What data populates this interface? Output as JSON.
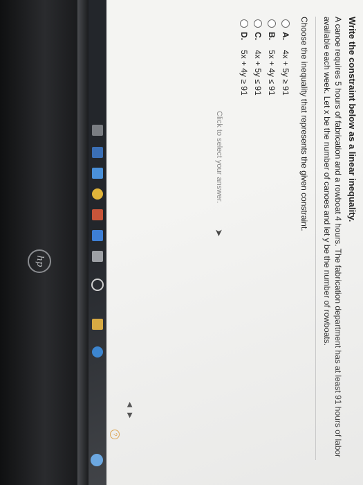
{
  "question": {
    "title": "Write the constraint below as a linear inequality.",
    "body": "A canoe requires 5 hours of fabrication and a rowboat 4 hours. The fabrication department has at least 91 hours of labor available each week. Let x be the number of canoes and let y be the number of rowboats.",
    "prompt": "Choose the inequality that represents the given constraint.",
    "options": [
      {
        "letter": "A.",
        "text": "4x + 5y ≥ 91"
      },
      {
        "letter": "B.",
        "text": "5x + 4y ≤ 91"
      },
      {
        "letter": "C.",
        "text": "4x + 5y ≤ 91"
      },
      {
        "letter": "D.",
        "text": "5x + 4y ≥ 91"
      }
    ],
    "hint": "Click to select your answer.",
    "help": "?"
  },
  "device": {
    "brand": "hp"
  },
  "colors": {
    "taskbar": "#23262b",
    "screen": "#f4f4f2",
    "accent": "#5aa2e6"
  }
}
